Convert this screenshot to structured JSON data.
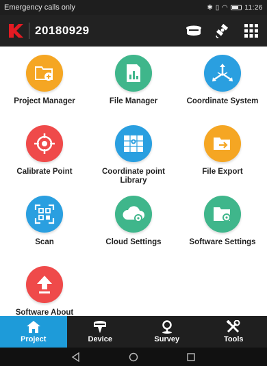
{
  "status_bar": {
    "carrier": "Emergency calls only",
    "time": "11:26",
    "icons": "✱ ▯ ◠"
  },
  "header": {
    "title": "20180929",
    "logo": "K",
    "icons": [
      "receiver-icon",
      "satellite-icon",
      "grid-menu-icon"
    ]
  },
  "tiles": [
    {
      "label": "Project Manager",
      "icon": "folder-add-icon",
      "color": "#f5a623"
    },
    {
      "label": "File Manager",
      "icon": "chart-file-icon",
      "color": "#3fb68b"
    },
    {
      "label": "Coordinate System",
      "icon": "axes-icon",
      "color": "#2a9fe0"
    },
    {
      "label": "Calibrate Point",
      "icon": "crosshair-icon",
      "color": "#ef4a4a"
    },
    {
      "label": "Coordinate point Library",
      "icon": "map-library-icon",
      "color": "#2a9fe0"
    },
    {
      "label": "File Export",
      "icon": "folder-export-icon",
      "color": "#f5a623"
    },
    {
      "label": "Scan",
      "icon": "qr-scan-icon",
      "color": "#2a9fe0"
    },
    {
      "label": "Cloud Settings",
      "icon": "cloud-gear-icon",
      "color": "#3fb68b"
    },
    {
      "label": "Software Settings",
      "icon": "folder-gear-icon",
      "color": "#3fb68b"
    },
    {
      "label": "Software About",
      "icon": "upload-arrow-icon",
      "color": "#ef4a4a"
    }
  ],
  "tabs": [
    {
      "label": "Project",
      "icon": "home-icon",
      "active": true
    },
    {
      "label": "Device",
      "icon": "gnss-receiver-icon",
      "active": false
    },
    {
      "label": "Survey",
      "icon": "location-pin-icon",
      "active": false
    },
    {
      "label": "Tools",
      "icon": "tools-icon",
      "active": false
    }
  ],
  "nav": [
    "back-icon",
    "home-circle-icon",
    "recent-apps-icon"
  ]
}
